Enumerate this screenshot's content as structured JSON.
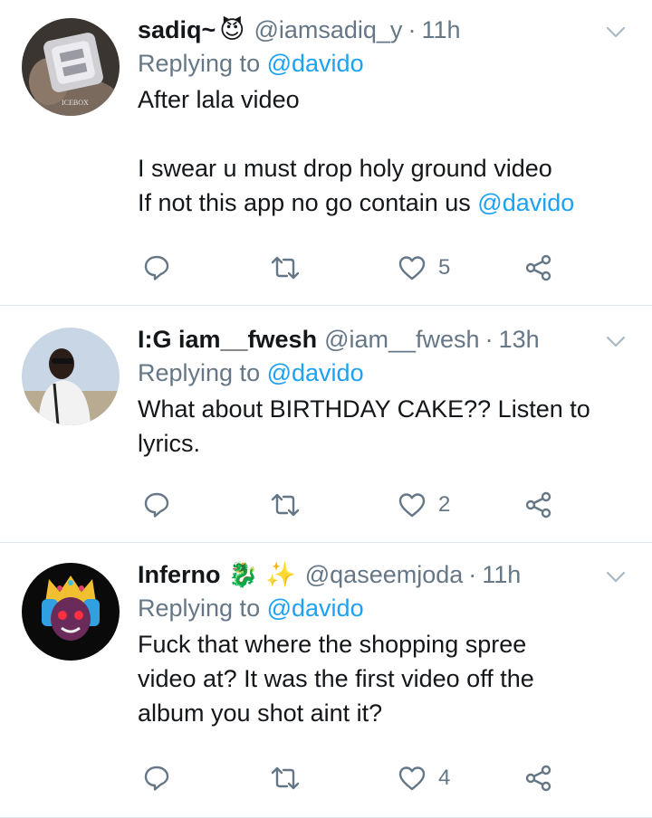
{
  "colors": {
    "link": "#1da1f2",
    "secondary": "#657786",
    "divider": "#e1e8ed"
  },
  "tweets": [
    {
      "name": "sadiq~",
      "name_emoji": "😈",
      "handle": "@iamsadiq_y",
      "separator": "·",
      "time": "11h",
      "replying_prefix": "Replying to",
      "replying_to": "@davido",
      "line1": "After lala video",
      "line2": "I swear u must drop holy ground video",
      "line3_text": "If not this app no go contain us",
      "line3_mention": "@davido",
      "avatar_caption": "ICEBOX",
      "likes": "5"
    },
    {
      "name": "I:G iam__fwesh",
      "handle": "@iam__fwesh",
      "separator": "·",
      "time": "13h",
      "replying_prefix": "Replying to",
      "replying_to": "@davido",
      "line1": "What about BIRTHDAY CAKE?? Listen to",
      "line2": "lyrics.",
      "likes": "2"
    },
    {
      "name": "Inferno",
      "name_emoji1": "🐉",
      "name_emoji2": "✨",
      "handle": "@qaseemjoda",
      "separator": "·",
      "time": "11h",
      "replying_prefix": "Replying to",
      "replying_to": "@davido",
      "line1": "Fuck that where the shopping spree",
      "line2": "video at? It was the first video off the",
      "line3": "album you shot aint it?",
      "likes": "4"
    }
  ],
  "icons": [
    "reply-icon",
    "retweet-icon",
    "like-icon",
    "share-icon",
    "caret-down-icon"
  ]
}
